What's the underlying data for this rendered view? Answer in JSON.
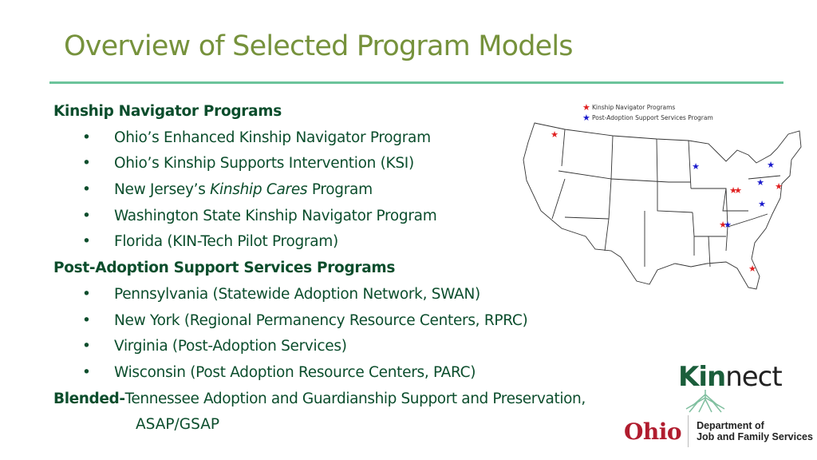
{
  "slide": {
    "title": "Overview of Selected Program Models",
    "colors": {
      "title": "#76923c",
      "rule": "#6cc49b",
      "body": "#0b4d2c",
      "kinship_star": "#e02020",
      "post_adoption_star": "#1a1acc"
    }
  },
  "sections": {
    "kinship": {
      "heading": "Kinship Navigator Programs",
      "items": [
        "Ohio’s Enhanced Kinship Navigator Program",
        "Ohio’s Kinship Supports Intervention (KSI)",
        {
          "prefix": "New Jersey’s ",
          "italic": "Kinship Cares",
          "suffix": " Program"
        },
        "Washington State Kinship Navigator Program",
        "Florida (KIN-Tech Pilot Program)"
      ]
    },
    "post_adoption": {
      "heading": "Post-Adoption Support Services Programs",
      "items": [
        "Pennsylvania (Statewide Adoption Network, SWAN)",
        "New York (Regional Permanency Resource Centers, RPRC)",
        "Virginia (Post-Adoption Services)",
        "Wisconsin (Post Adoption Resource Centers, PARC)"
      ]
    },
    "blended": {
      "label": "Blended-",
      "text": "Tennessee Adoption and Guardianship Support and Preservation,",
      "continuation": "ASAP/GSAP"
    }
  },
  "bullet_glyph": "•",
  "map": {
    "legend": [
      {
        "label": "Kinship Navigator Programs",
        "type": "kinship"
      },
      {
        "label": "Post-Adoption Support Services Program",
        "type": "post_adoption"
      }
    ],
    "markers": [
      {
        "state": "Washington",
        "type": "kinship"
      },
      {
        "state": "Wisconsin",
        "type": "post_adoption"
      },
      {
        "state": "New York",
        "type": "post_adoption"
      },
      {
        "state": "Pennsylvania",
        "type": "post_adoption"
      },
      {
        "state": "New Jersey",
        "type": "kinship"
      },
      {
        "state": "Ohio",
        "type": "kinship"
      },
      {
        "state": "Ohio",
        "type": "kinship"
      },
      {
        "state": "Virginia",
        "type": "post_adoption"
      },
      {
        "state": "Tennessee",
        "type": "kinship"
      },
      {
        "state": "Tennessee",
        "type": "post_adoption"
      },
      {
        "state": "Florida",
        "type": "kinship"
      }
    ]
  },
  "logos": {
    "kinnect": {
      "kin": "Kin",
      "nect": "nect"
    },
    "ohio": {
      "word": "Ohio",
      "dept_line1": "Department of",
      "dept_line2": "Job and Family Services"
    }
  }
}
